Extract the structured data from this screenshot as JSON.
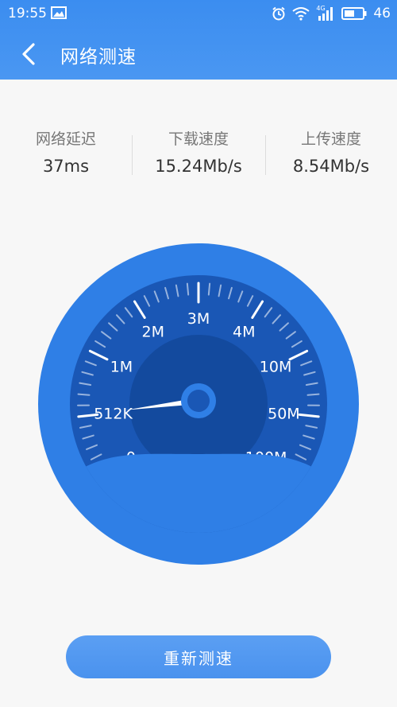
{
  "status_bar": {
    "time": "19:55",
    "network": "4G",
    "battery": "46",
    "icons": [
      "image-icon",
      "alarm-icon",
      "wifi-icon",
      "signal-icon",
      "battery-icon"
    ]
  },
  "nav": {
    "title": "网络测速",
    "back_icon": "chevron-left-icon"
  },
  "stats": [
    {
      "label": "网络延迟",
      "value": "37ms"
    },
    {
      "label": "下载速度",
      "value": "15.24Mb/s"
    },
    {
      "label": "上传速度",
      "value": "8.54Mb/s"
    }
  ],
  "gauge": {
    "labels": [
      "0",
      "512K",
      "1M",
      "2M",
      "3M",
      "4M",
      "10M",
      "50M",
      "100M"
    ],
    "needle_position": 0.12
  },
  "action": {
    "retest_label": "重新测速"
  },
  "colors": {
    "header": "#3b8df0",
    "gauge_outer": "#2f7fe6",
    "gauge_inner": "#1a57b5",
    "gauge_core": "#134a9e",
    "wave": "#2f7fe6",
    "button": "#5199f2",
    "background": "#f7f7f7"
  }
}
